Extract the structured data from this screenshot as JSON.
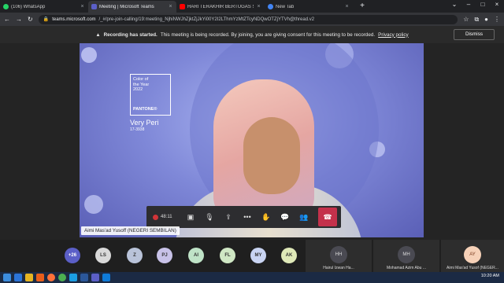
{
  "browser": {
    "tabs": [
      {
        "label": "(106) WhatsApp",
        "color": "#25d366"
      },
      {
        "label": "Meeting | Microsoft Teams",
        "color": "#5b5fc7"
      },
      {
        "label": "HARI TERAKHIR BERTUGAS SEBA...",
        "color": "#ff0000"
      },
      {
        "label": "New Tab",
        "color": "#4285f4"
      }
    ],
    "new_tab_symbol": "+",
    "url_host": "teams.microsoft.com",
    "url_rest": "/_#/pre-join-calling/19:meeting_NjhiNWJhZjktZjJkYi00Y2I2LThmYzMtZTcyNDQwOTZjYTVh@thread.v2"
  },
  "recording_notice": {
    "bold": "Recording has started.",
    "text": "This meeting is being recorded. By joining, you are giving consent for this meeting to be recorded.",
    "link": "Privacy policy",
    "dismiss": "Dismiss"
  },
  "video": {
    "pantone_line1": "Color of",
    "pantone_line2": "the Year",
    "pantone_line3": "2022",
    "pantone_brand": "PANTONE®",
    "color_name": "Very Peri",
    "color_code": "17-3938",
    "speaker": "Aimi Mas'ad Yusoff (NEGERI SEMBILAN)"
  },
  "controls": {
    "timer": "48:11"
  },
  "roster": {
    "overflow": "+26",
    "avatars": [
      {
        "initials": "LS",
        "color": "#d9d9d9"
      },
      {
        "initials": "Z",
        "color": "#b9c3d9"
      },
      {
        "initials": "PJ",
        "color": "#c8c2e8"
      },
      {
        "initials": "AI",
        "color": "#bfe3c7"
      },
      {
        "initials": "FL",
        "color": "#cfe7c4"
      },
      {
        "initials": "MY",
        "color": "#c9d4f3"
      },
      {
        "initials": "AK",
        "color": "#dfe9b8"
      }
    ],
    "tiles": [
      {
        "initials": "HH",
        "name": "Hairul Izwan Ha..."
      },
      {
        "initials": "MH",
        "name": "Mohamad Azim Abu ..."
      },
      {
        "initials": "AY",
        "name": "Aimi Mas'ad Yusof (NEGER..."
      }
    ]
  },
  "taskbar": {
    "time": "10:20 AM"
  }
}
